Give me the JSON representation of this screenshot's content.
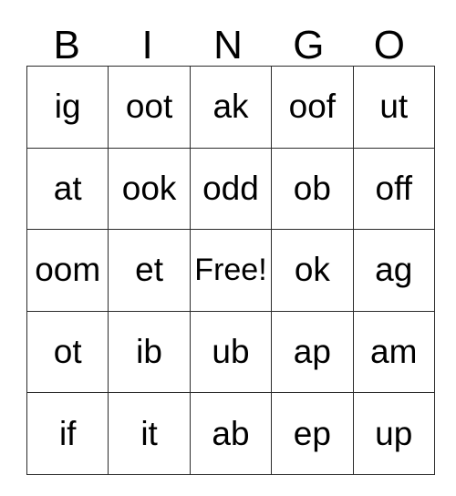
{
  "card": {
    "title": "BINGO",
    "header": {
      "letters": [
        "B",
        "I",
        "N",
        "G",
        "O"
      ]
    },
    "grid": {
      "columns": 5,
      "rows": 5,
      "free_space": {
        "row": 2,
        "column": 2,
        "label": "Free!"
      },
      "cells": [
        [
          "ig",
          "oot",
          "ak",
          "oof",
          "ut"
        ],
        [
          "at",
          "ook",
          "odd",
          "ob",
          "off"
        ],
        [
          "oom",
          "et",
          "Free!",
          "ok",
          "ag"
        ],
        [
          "ot",
          "ib",
          "ub",
          "ap",
          "am"
        ],
        [
          "if",
          "it",
          "ab",
          "ep",
          "up"
        ]
      ]
    },
    "colors": {
      "background": "#ffffff",
      "text": "#000000",
      "border": "#2b2b2b"
    }
  }
}
